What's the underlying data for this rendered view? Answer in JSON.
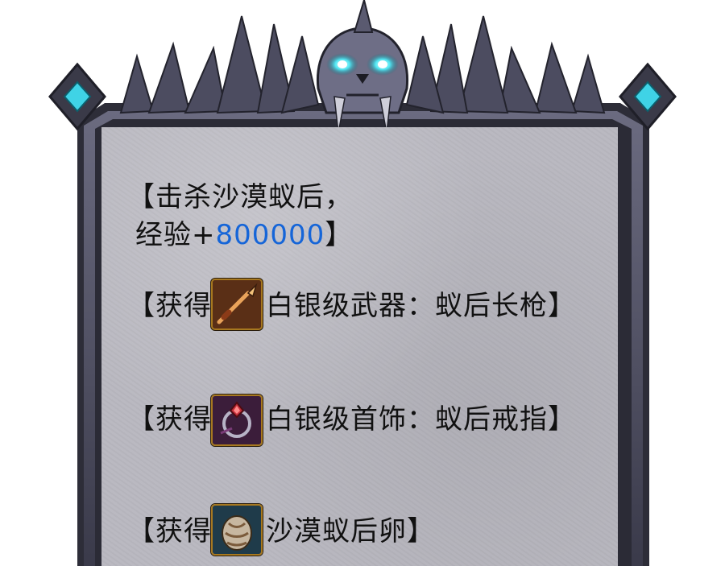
{
  "kill_reward": {
    "open_bracket": "【",
    "kill_text": "击杀沙漠蚁后，",
    "exp_label": "经验+",
    "exp_value": "800000",
    "close_bracket": "】"
  },
  "rewards": [
    {
      "open_bracket": "【",
      "prefix": "获得",
      "item_name": "白银级武器：蚁后长枪",
      "close_bracket": "】",
      "icon": "spear-icon"
    },
    {
      "open_bracket": "【",
      "prefix": "获得",
      "item_name": "白银级首饰：蚁后戒指",
      "close_bracket": "】",
      "icon": "ring-icon"
    },
    {
      "open_bracket": "【",
      "prefix": "获得",
      "item_name": "沙漠蚁后卵",
      "close_bracket": "】",
      "icon": "egg-icon"
    }
  ],
  "colors": {
    "exp_value": "#1565d8",
    "stone": "#b9b8c0",
    "frame": "#4a4a5c",
    "gem": "#3fd3e6"
  }
}
